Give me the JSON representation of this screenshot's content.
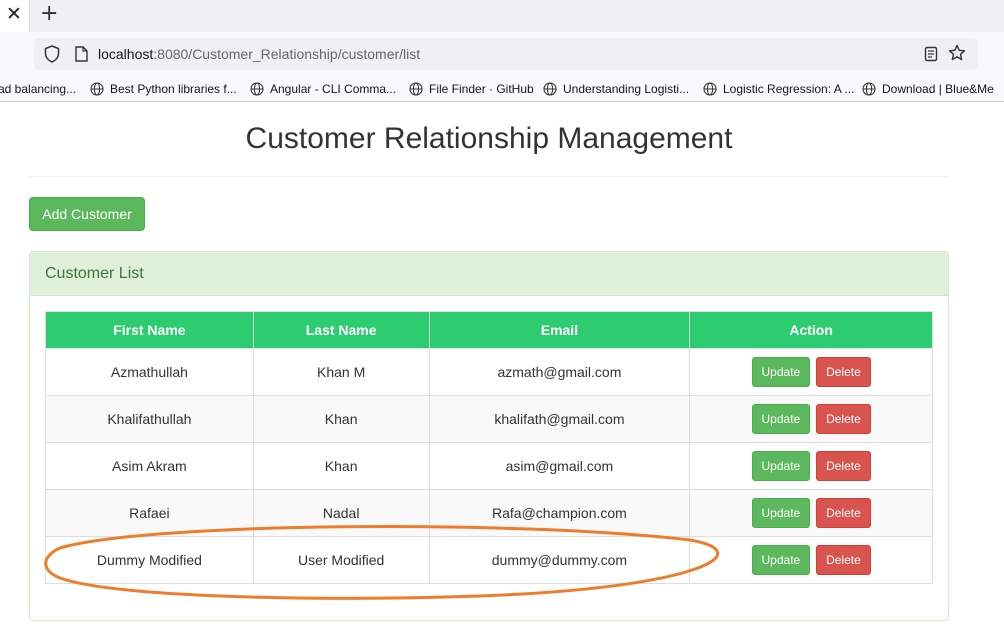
{
  "browser": {
    "tab_close_glyph": "✕",
    "new_tab_glyph": "+",
    "url_host": "localhost",
    "url_rest": ":8080/Customer_Relationship/customer/list",
    "bookmarks": [
      {
        "label": "ad balancing...",
        "icon": ""
      },
      {
        "label": "Best Python libraries f...",
        "icon": "globe-icon"
      },
      {
        "label": "Angular - CLI Comma...",
        "icon": "globe-icon"
      },
      {
        "label": "File Finder · GitHub",
        "icon": "globe-icon"
      },
      {
        "label": "Understanding Logisti...",
        "icon": "globe-icon"
      },
      {
        "label": "Logistic Regression: A ...",
        "icon": "globe-icon"
      },
      {
        "label": "Download | Blue&Me",
        "icon": "globe-icon"
      }
    ]
  },
  "page": {
    "title": "Customer Relationship Management",
    "add_button_label": "Add Customer",
    "panel_title": "Customer List"
  },
  "table": {
    "headers": [
      "First Name",
      "Last Name",
      "Email",
      "Action"
    ],
    "rows": [
      {
        "first_name": "Azmathullah",
        "last_name": "Khan M",
        "email": "azmath@gmail.com"
      },
      {
        "first_name": "Khalifathullah",
        "last_name": "Khan",
        "email": "khalifath@gmail.com"
      },
      {
        "first_name": "Asim Akram",
        "last_name": "Khan",
        "email": "asim@gmail.com"
      },
      {
        "first_name": "Rafaei",
        "last_name": "Nadal",
        "email": "Rafa@champion.com"
      },
      {
        "first_name": "Dummy Modified",
        "last_name": "User Modified",
        "email": "dummy@dummy.com"
      }
    ],
    "update_label": "Update",
    "delete_label": "Delete"
  },
  "colors": {
    "header_green": "#2ecc71",
    "success": "#5cb85c",
    "danger": "#d9534f",
    "panel_heading": "#dff0d8",
    "annotation_orange": "#ee7d2b"
  }
}
